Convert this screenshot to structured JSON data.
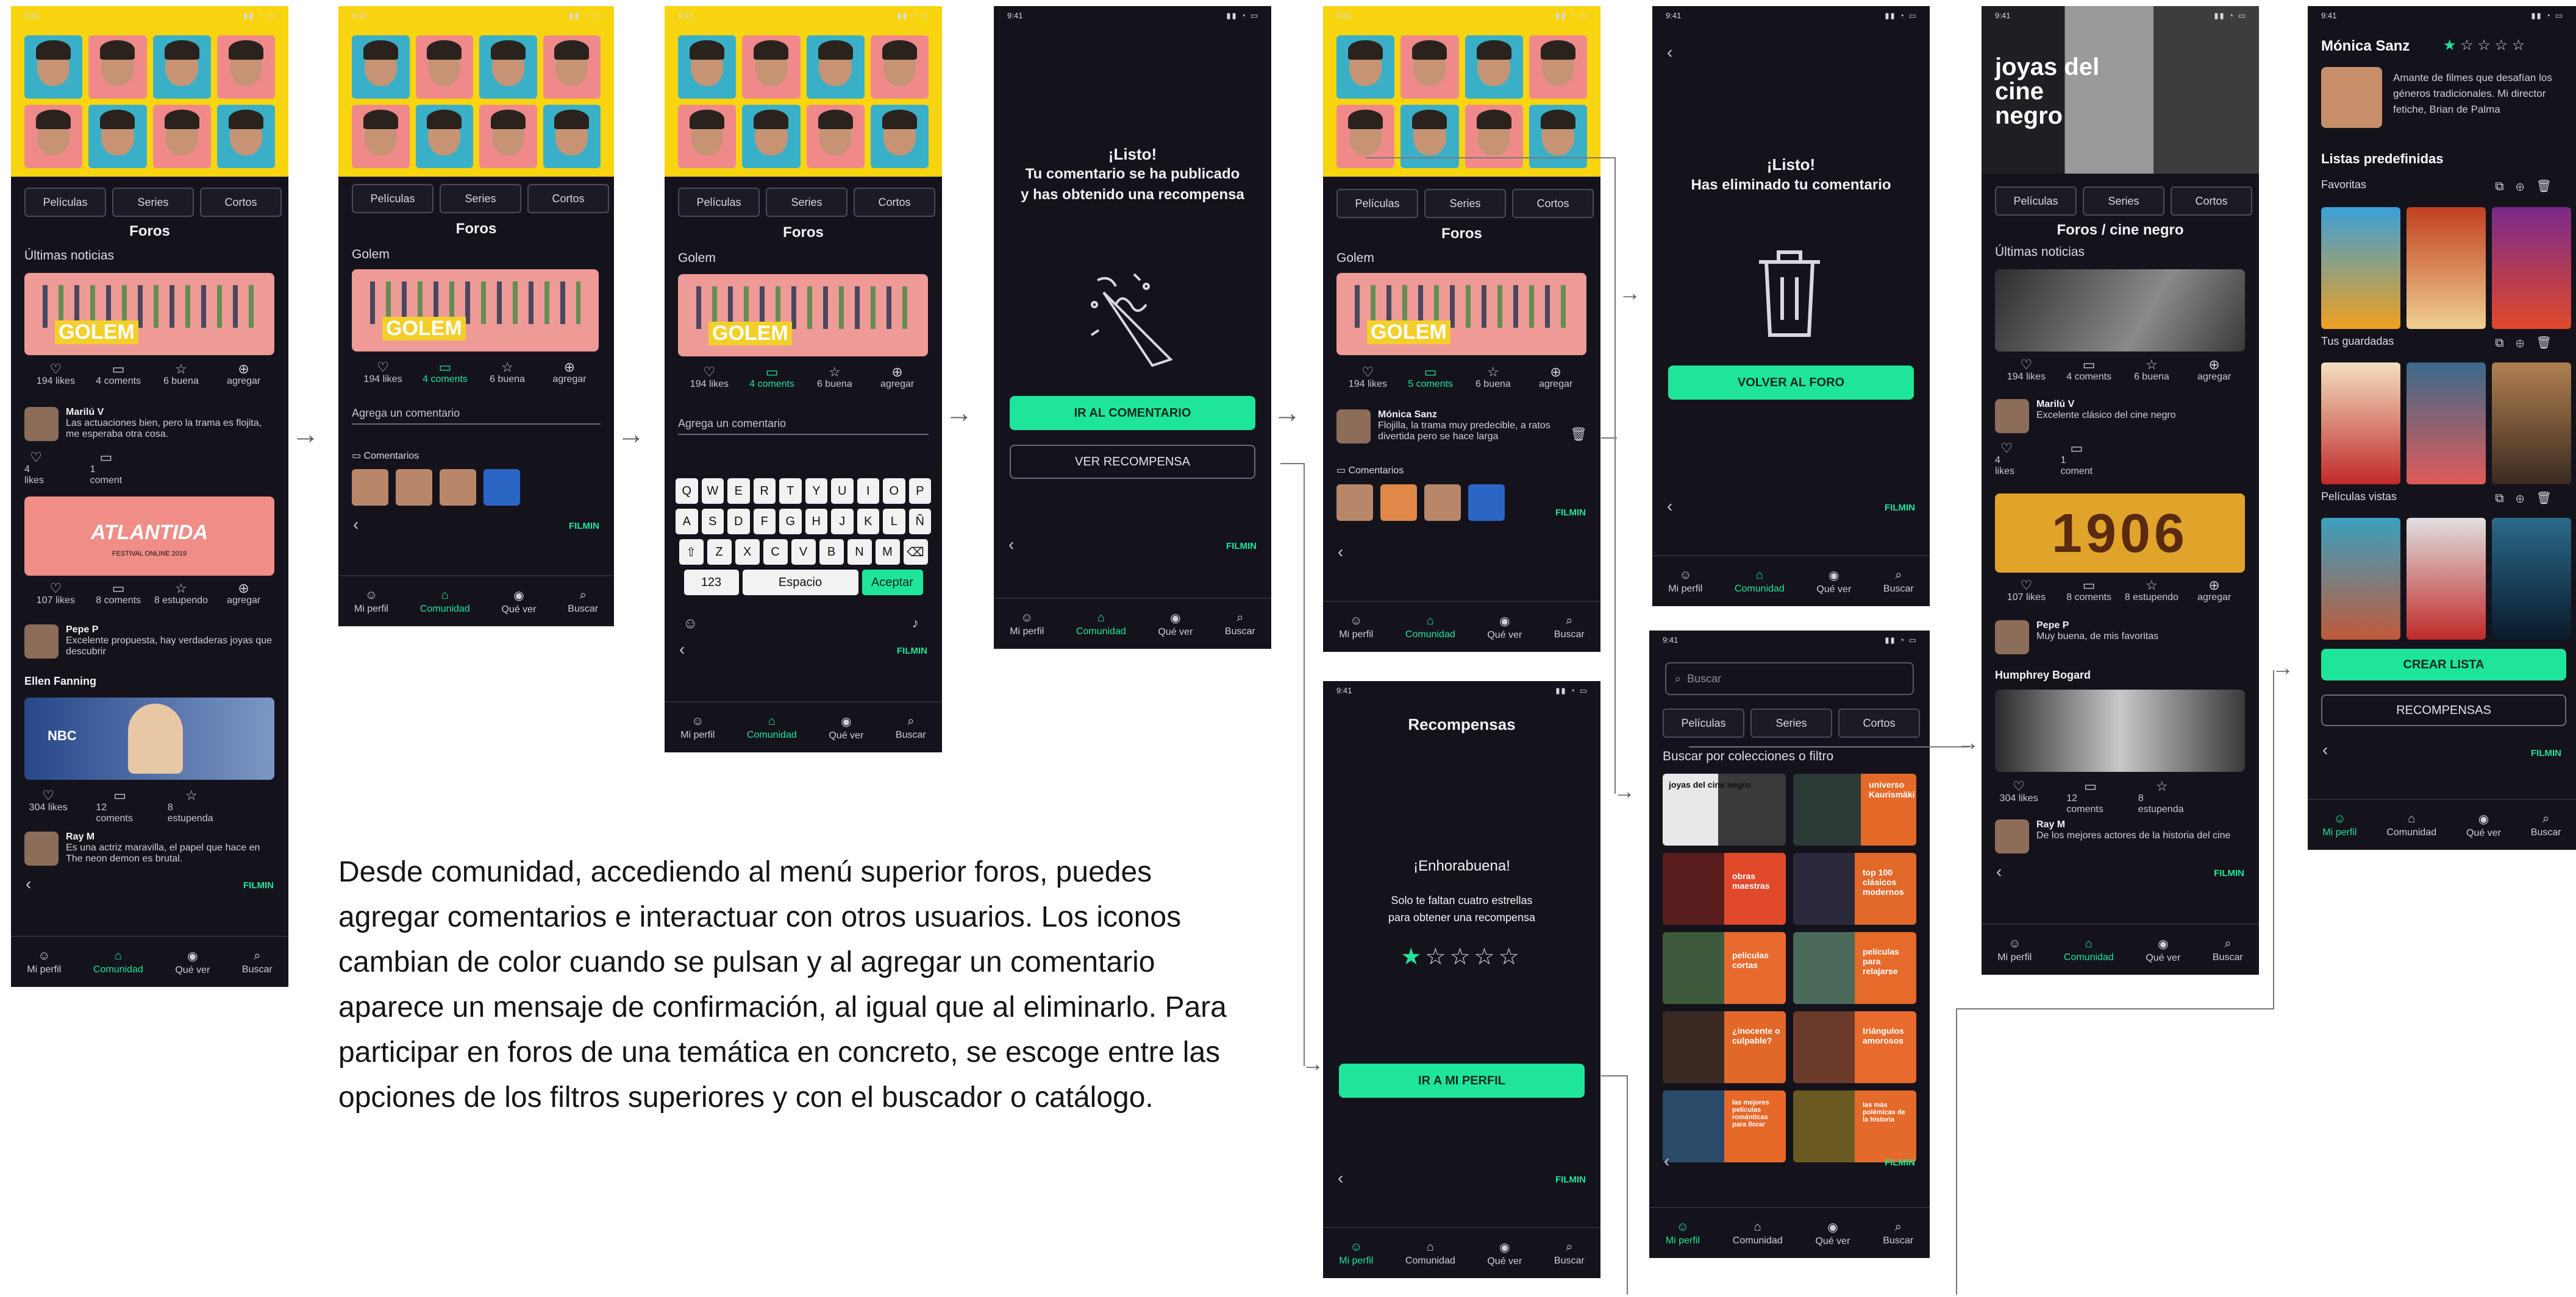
{
  "status_time": "9:41",
  "status_icons": "▮▮ ◔ ▭",
  "tabs": [
    "Películas",
    "Series",
    "Cortos"
  ],
  "nav": [
    {
      "label": "Mi perfil",
      "icon": "user-icon"
    },
    {
      "label": "Comunidad",
      "icon": "community-icon"
    },
    {
      "label": "Qué ver",
      "icon": "eye-icon"
    },
    {
      "label": "Buscar",
      "icon": "search-icon"
    }
  ],
  "brand": "FILMIN",
  "foros_title": "Foros",
  "golem_label": "Golem",
  "golem_word": "GOLEM",
  "actions": {
    "likes": "194 likes",
    "coments": "4 coments",
    "coments_5": "5 coments",
    "buena": "6 buena",
    "agregar": "agregar"
  },
  "screen1": {
    "ultimas": "Últimas noticias",
    "c1_name": "Marilú V",
    "c1_text": "Las actuaciones bien, pero la trama es flojita, me esperaba otra cosa.",
    "c1_likes": "4 likes",
    "c1_coments": "1 coment",
    "atlantida": "ATLANTIDA",
    "atl_sub": "FESTIVAL ONLINE 2019",
    "a2": {
      "likes": "107 likes",
      "coments": "8 coments",
      "estupendo": "8 estupendo",
      "agregar": "agregar"
    },
    "c2_name": "Pepe P",
    "c2_text": "Excelente propuesta, hay verdaderas joyas que descubrir",
    "ellen": "Ellen Fanning",
    "nbc": "NBC",
    "a3": {
      "likes": "304 likes",
      "coments": "12 coments",
      "estupenda": "8 estupenda"
    },
    "c3_name": "Ray M",
    "c3_text": "Es una actriz maravilla, el papel que hace en The neon demon es brutal."
  },
  "screen2": {
    "agrega": "Agrega un comentario",
    "comentarios": "Comentarios"
  },
  "screen3": {
    "agrega": "Agrega un comentario",
    "rows": [
      [
        "Q",
        "W",
        "E",
        "R",
        "T",
        "Y",
        "U",
        "I",
        "O",
        "P"
      ],
      [
        "A",
        "S",
        "D",
        "F",
        "G",
        "H",
        "J",
        "K",
        "L",
        "Ñ"
      ],
      [
        "⇧",
        "Z",
        "X",
        "C",
        "V",
        "B",
        "N",
        "M",
        "⌫"
      ]
    ],
    "k123": "123",
    "espacio": "Espacio",
    "aceptar": "Aceptar"
  },
  "screen4": {
    "title": "¡Listo!",
    "line1": "Tu comentario se ha publicado",
    "line2": "y has obtenido una recompensa",
    "btn1": "IR AL COMENTARIO",
    "btn2": "VER RECOMPENSA"
  },
  "screen5": {
    "name": "Mónica Sanz",
    "text": "Flojilla, la trama muy predecible, a ratos divertida pero se hace larga",
    "comentarios": "Comentarios"
  },
  "screen6": {
    "title": "¡Listo!",
    "line1": "Has eliminado tu comentario",
    "btn": "VOLVER AL FORO"
  },
  "screen7": {
    "title": "Recompensas",
    "enhora": "¡Enhorabuena!",
    "line1": "Solo te faltan cuatro estrellas",
    "line2": "para obtener una recompensa",
    "btn": "IR A MI PERFIL"
  },
  "screen8": {
    "search_placeholder": "Buscar",
    "buscar_por": "Buscar por colecciones o filtro",
    "posters": [
      "joyas del cine negro",
      "universo Kaurismäki",
      "obras maestras",
      "top 100 clásicos modernos",
      "películas cortas",
      "películas para relajarse",
      "¿inocente o culpable?",
      "triángulos amorosos",
      "las mejores películas románticas para llorar",
      "las más polémicas de la historia"
    ]
  },
  "screen9": {
    "banner_title": "joyas del cine negro",
    "foros_title": "Foros / cine negro",
    "ultimas": "Últimas noticias",
    "a1": {
      "likes": "194 likes",
      "coments": "4 coments",
      "buena": "6 buena",
      "agregar": "agregar"
    },
    "c1_name": "Marilú V",
    "c1_text": "Excelente clásico del cine negro",
    "c1_likes": "4 likes",
    "c1_coments": "1 coment",
    "year": "1906",
    "a2": {
      "likes": "107 likes",
      "coments": "8 coments",
      "estupendo": "8 estupendo",
      "agregar": "agregar"
    },
    "c2_name": "Pepe P",
    "c2_text": "Muy buena, de mis favoritas",
    "bogard": "Humphrey Bogard",
    "a3": {
      "likes": "304 likes",
      "coments": "12 coments",
      "estupenda": "8 estupenda"
    },
    "c3_name": "Ray M",
    "c3_text": "De los mejores actores de la historia del cine"
  },
  "screen10": {
    "name": "Mónica Sanz",
    "stars": "★ ☆ ☆ ☆ ☆",
    "bio": "Amante de filmes que desafían los géneros tradicionales. Mi director fetiche, Brian de Palma",
    "listas": "Listas predefinidas",
    "favoritas": "Favoritas",
    "guardadas": "Tus guardadas",
    "vistas": "Películas vistas",
    "crear": "CREAR LISTA",
    "recompensas": "RECOMPENSAS"
  },
  "description": "Desde comunidad, accediendo al menú superior foros, puedes agregar comentarios e interactuar con otros usuarios. Los iconos cambian de color cuando se pulsan y al agregar un comentario aparece un mensaje de confirmación, al igual que al eliminarlo. Para participar en foros de una temática en concreto, se escoge entre las opciones de los filtros superiores y con el buscador o  catálogo.",
  "colors": {
    "accent": "#1fe59a",
    "bg": "#14131c",
    "banner": "#f9d410",
    "poster_pink": "#ee9a96"
  }
}
